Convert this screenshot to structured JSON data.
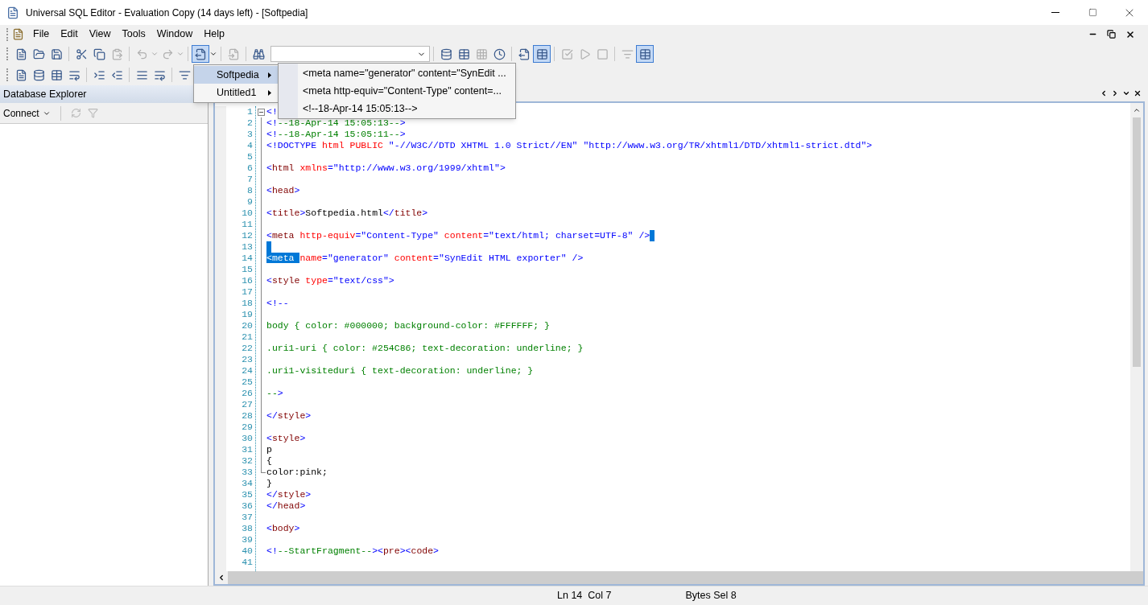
{
  "window": {
    "title": "Universal SQL Editor - Evaluation Copy (14 days left) - [Softpedia]"
  },
  "menu": [
    "File",
    "Edit",
    "View",
    "Tools",
    "Window",
    "Help"
  ],
  "dropdown": {
    "items": [
      {
        "label": "Softpedia",
        "selected": true
      },
      {
        "label": "Untitled1",
        "selected": false
      }
    ],
    "submenu": [
      "<meta name=\"generator\" content=\"SynEdit ...",
      "<meta http-equiv=\"Content-Type\" content=...",
      "<!--18-Apr-14 15:05:13-->"
    ]
  },
  "database_explorer": {
    "title": "Database Explorer",
    "connect": "Connect"
  },
  "editor": {
    "lines": [
      {
        "number": "1",
        "fold_start": true,
        "tokens": [
          {
            "kind": "punct",
            "text": "<!"
          }
        ]
      },
      {
        "number": "2",
        "tokens": [
          {
            "kind": "punct",
            "text": "<!"
          },
          {
            "kind": "comment",
            "text": "--18-Apr-14 15:05:13--"
          },
          {
            "kind": "punct",
            "text": ">"
          }
        ]
      },
      {
        "number": "3",
        "tokens": [
          {
            "kind": "punct",
            "text": "<!"
          },
          {
            "kind": "comment",
            "text": "--18-Apr-14 15:05:11--"
          },
          {
            "kind": "punct",
            "text": ">"
          }
        ]
      },
      {
        "number": "4",
        "tokens": [
          {
            "kind": "punct",
            "text": "<!DOCTYPE"
          },
          {
            "kind": "attr",
            "text": " html PUBLIC"
          },
          {
            "kind": "value",
            "text": " \"-//W3C//DTD XHTML 1.0 Strict//EN\" \"http://www.w3.org/TR/xhtml1/DTD/xhtml1-strict.dtd\""
          },
          {
            "kind": "punct",
            "text": ">"
          }
        ]
      },
      {
        "number": "5"
      },
      {
        "number": "6",
        "tokens": [
          {
            "kind": "punct",
            "text": "<"
          },
          {
            "kind": "tag",
            "text": "html"
          },
          {
            "kind": "attr",
            "text": " xmlns"
          },
          {
            "kind": "value",
            "text": "=\"http://www.w3.org/1999/xhtml\""
          },
          {
            "kind": "punct",
            "text": ">"
          }
        ]
      },
      {
        "number": "7"
      },
      {
        "number": "8",
        "tokens": [
          {
            "kind": "punct",
            "text": "<"
          },
          {
            "kind": "tag",
            "text": "head"
          },
          {
            "kind": "punct",
            "text": ">"
          }
        ]
      },
      {
        "number": "9"
      },
      {
        "number": "10",
        "tokens": [
          {
            "kind": "punct",
            "text": "<"
          },
          {
            "kind": "tag",
            "text": "title"
          },
          {
            "kind": "punct",
            "text": ">"
          },
          {
            "kind": "text",
            "text": "Softpedia.html"
          },
          {
            "kind": "punct",
            "text": "</"
          },
          {
            "kind": "tag",
            "text": "title"
          },
          {
            "kind": "punct",
            "text": ">"
          }
        ]
      },
      {
        "number": "11"
      },
      {
        "number": "12",
        "selection_mark": true,
        "tokens": [
          {
            "kind": "punct",
            "text": "<"
          },
          {
            "kind": "tag",
            "text": "meta"
          },
          {
            "kind": "attr",
            "text": " http-equiv"
          },
          {
            "kind": "value",
            "text": "=\"Content-Type\""
          },
          {
            "kind": "attr",
            "text": " content"
          },
          {
            "kind": "value",
            "text": "=\"text/html; charset=UTF-8\""
          },
          {
            "kind": "punct",
            "text": " />"
          }
        ]
      },
      {
        "number": "13",
        "selection_mark": true
      },
      {
        "number": "14",
        "tokens": [
          {
            "text": "<",
            "selected": true
          },
          {
            "text": "meta ",
            "selected": true
          },
          {
            "kind": "attr",
            "text": "name"
          },
          {
            "kind": "value",
            "text": "=\"generator\""
          },
          {
            "kind": "attr",
            "text": " content"
          },
          {
            "kind": "value",
            "text": "=\"SynEdit HTML exporter\""
          },
          {
            "kind": "punct",
            "text": " />"
          }
        ]
      },
      {
        "number": "15"
      },
      {
        "number": "16",
        "tokens": [
          {
            "kind": "punct",
            "text": "<"
          },
          {
            "kind": "tag",
            "text": "style"
          },
          {
            "kind": "attr",
            "text": " type"
          },
          {
            "kind": "value",
            "text": "=\"text/css\""
          },
          {
            "kind": "punct",
            "text": ">"
          }
        ]
      },
      {
        "number": "17"
      },
      {
        "number": "18",
        "tokens": [
          {
            "kind": "punct",
            "text": "<!--"
          }
        ]
      },
      {
        "number": "19"
      },
      {
        "number": "20",
        "tokens": [
          {
            "kind": "comment",
            "text": "body { color: #000000; background-color: #FFFFFF; }"
          }
        ]
      },
      {
        "number": "21"
      },
      {
        "number": "22",
        "tokens": [
          {
            "kind": "comment",
            "text": ".uri1-uri { color: #254C86; text-decoration: underline; }"
          }
        ]
      },
      {
        "number": "23"
      },
      {
        "number": "24",
        "tokens": [
          {
            "kind": "comment",
            "text": ".uri1-visiteduri { text-decoration: underline; }"
          }
        ]
      },
      {
        "number": "25"
      },
      {
        "number": "26",
        "tokens": [
          {
            "kind": "comment",
            "text": "--"
          },
          {
            "kind": "punct",
            "text": ">"
          }
        ]
      },
      {
        "number": "27"
      },
      {
        "number": "28",
        "tokens": [
          {
            "kind": "punct",
            "text": "</"
          },
          {
            "kind": "tag",
            "text": "style"
          },
          {
            "kind": "punct",
            "text": ">"
          }
        ]
      },
      {
        "number": "29"
      },
      {
        "number": "30",
        "tokens": [
          {
            "kind": "punct",
            "text": "<"
          },
          {
            "kind": "tag",
            "text": "style"
          },
          {
            "kind": "punct",
            "text": ">"
          }
        ]
      },
      {
        "number": "31",
        "tokens": [
          {
            "kind": "text",
            "text": "p"
          }
        ]
      },
      {
        "number": "32",
        "tokens": [
          {
            "kind": "text",
            "text": "{"
          }
        ]
      },
      {
        "number": "33",
        "fold_end": true,
        "tokens": [
          {
            "kind": "text",
            "text": "color:pink;"
          }
        ]
      },
      {
        "number": "34",
        "tokens": [
          {
            "kind": "text",
            "text": "}"
          }
        ]
      },
      {
        "number": "35",
        "tokens": [
          {
            "kind": "punct",
            "text": "</"
          },
          {
            "kind": "tag",
            "text": "style"
          },
          {
            "kind": "punct",
            "text": ">"
          }
        ]
      },
      {
        "number": "36",
        "tokens": [
          {
            "kind": "punct",
            "text": "</"
          },
          {
            "kind": "tag",
            "text": "head"
          },
          {
            "kind": "punct",
            "text": ">"
          }
        ]
      },
      {
        "number": "37"
      },
      {
        "number": "38",
        "tokens": [
          {
            "kind": "punct",
            "text": "<"
          },
          {
            "kind": "tag",
            "text": "body"
          },
          {
            "kind": "punct",
            "text": ">"
          }
        ]
      },
      {
        "number": "39"
      },
      {
        "number": "40",
        "tokens": [
          {
            "kind": "punct",
            "text": "<!"
          },
          {
            "kind": "comment",
            "text": "--StartFragment--"
          },
          {
            "kind": "punct",
            "text": "><"
          },
          {
            "kind": "tag",
            "text": "pre"
          },
          {
            "kind": "punct",
            "text": "><"
          },
          {
            "kind": "tag",
            "text": "code"
          },
          {
            "kind": "punct",
            "text": ">"
          }
        ]
      },
      {
        "number": "41"
      }
    ]
  },
  "status_bar": {
    "position": "Ln 14  Col 7",
    "selection": "Bytes Sel 8"
  }
}
